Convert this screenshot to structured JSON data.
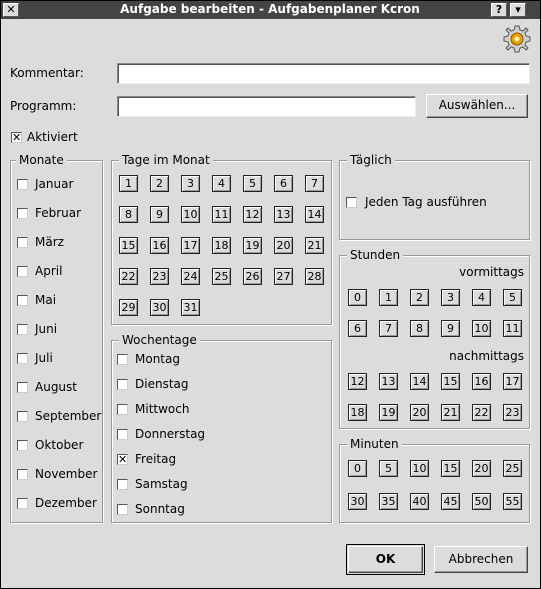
{
  "window": {
    "title": "Aufgabe bearbeiten - Aufgabenplaner Kcron",
    "close_icon": "close-icon",
    "help_icon": "help-icon",
    "menu_icon": "menu-icon"
  },
  "form": {
    "kommentar_label": "Kommentar:",
    "kommentar_value": "",
    "programm_label": "Programm:",
    "programm_value": "",
    "auswaehlen_label": "Auswählen...",
    "aktiviert_label": "Aktiviert",
    "aktiviert_checked": true
  },
  "monate": {
    "title": "Monate",
    "items": [
      "Januar",
      "Februar",
      "März",
      "April",
      "Mai",
      "Juni",
      "Juli",
      "August",
      "September",
      "Oktober",
      "November",
      "Dezember"
    ]
  },
  "tage": {
    "title": "Tage im Monat",
    "days": [
      "1",
      "2",
      "3",
      "4",
      "5",
      "6",
      "7",
      "8",
      "9",
      "10",
      "11",
      "12",
      "13",
      "14",
      "15",
      "16",
      "17",
      "18",
      "19",
      "20",
      "21",
      "22",
      "23",
      "24",
      "25",
      "26",
      "27",
      "28",
      "29",
      "30",
      "31"
    ]
  },
  "wochentage": {
    "title": "Wochentage",
    "items": [
      "Montag",
      "Dienstag",
      "Mittwoch",
      "Donnerstag",
      "Freitag",
      "Samstag",
      "Sonntag"
    ],
    "checked": [
      "Freitag"
    ]
  },
  "taeglich": {
    "title": "Täglich",
    "jeden_tag_label": "Jeden Tag ausführen"
  },
  "stunden": {
    "title": "Stunden",
    "vormittags_label": "vormittags",
    "nachmittags_label": "nachmittags",
    "am": [
      "0",
      "1",
      "2",
      "3",
      "4",
      "5",
      "6",
      "7",
      "8",
      "9",
      "10",
      "11"
    ],
    "pm": [
      "12",
      "13",
      "14",
      "15",
      "16",
      "17",
      "18",
      "19",
      "20",
      "21",
      "22",
      "23"
    ]
  },
  "minuten": {
    "title": "Minuten",
    "values": [
      "0",
      "5",
      "10",
      "15",
      "20",
      "25",
      "30",
      "35",
      "40",
      "45",
      "50",
      "55"
    ]
  },
  "buttons": {
    "ok_label": "OK",
    "abbrechen_label": "Abbrechen"
  },
  "colors": {
    "titlebar": "#444444",
    "dialog_bg": "#dcdcdc",
    "gear_accent": "#e8a000"
  }
}
